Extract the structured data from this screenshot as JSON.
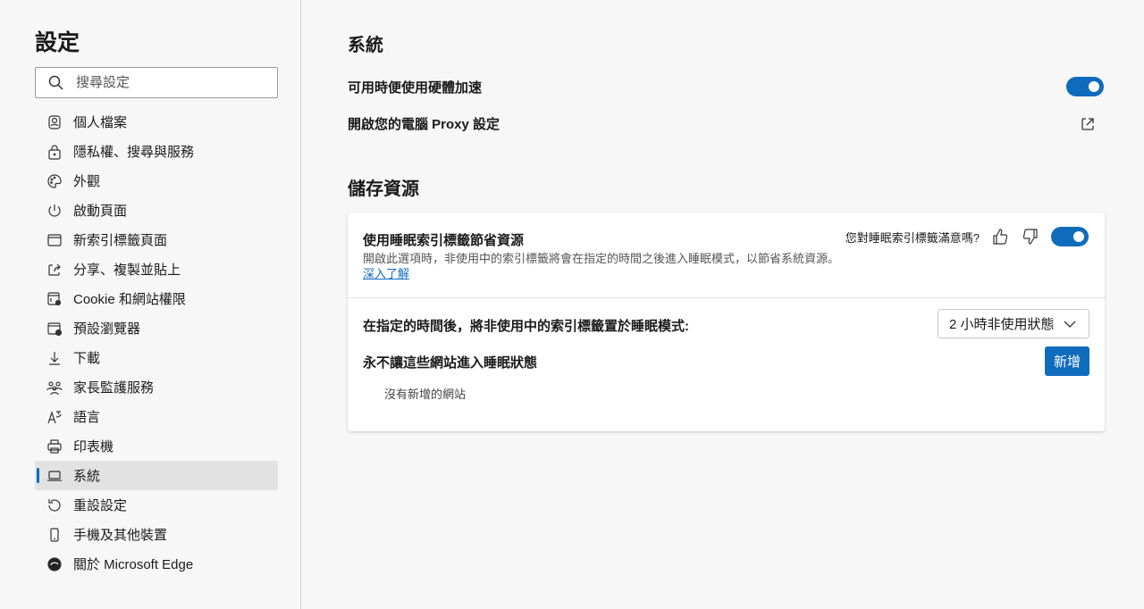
{
  "sidebar": {
    "title": "設定",
    "search_placeholder": "搜尋設定",
    "items": [
      {
        "label": "個人檔案",
        "icon": "profile-icon"
      },
      {
        "label": "隱私權、搜尋與服務",
        "icon": "lock-icon"
      },
      {
        "label": "外觀",
        "icon": "palette-icon"
      },
      {
        "label": "啟動頁面",
        "icon": "power-icon"
      },
      {
        "label": "新索引標籤頁面",
        "icon": "new-tab-icon"
      },
      {
        "label": "分享、複製並貼上",
        "icon": "share-icon"
      },
      {
        "label": "Cookie 和網站權限",
        "icon": "cookie-settings-icon"
      },
      {
        "label": "預設瀏覽器",
        "icon": "default-browser-icon"
      },
      {
        "label": "下載",
        "icon": "download-icon"
      },
      {
        "label": "家長監護服務",
        "icon": "family-icon"
      },
      {
        "label": "語言",
        "icon": "language-icon"
      },
      {
        "label": "印表機",
        "icon": "printer-icon"
      },
      {
        "label": "系統",
        "icon": "laptop-icon",
        "active": true
      },
      {
        "label": "重設設定",
        "icon": "reset-icon"
      },
      {
        "label": "手機及其他裝置",
        "icon": "phone-icon"
      },
      {
        "label": "關於 Microsoft Edge",
        "icon": "edge-logo-icon"
      }
    ]
  },
  "main": {
    "system_heading": "系統",
    "hardware_accel": {
      "label": "可用時便使用硬體加速",
      "enabled": true
    },
    "proxy": {
      "label": "開啟您的電腦 Proxy 設定"
    },
    "resources_heading": "儲存資源",
    "sleeping_tabs": {
      "title": "使用睡眠索引標籤節省資源",
      "description": "開啟此選項時，非使用中的索引標籤將會在指定的時間之後進入睡眠模式，以節省系統資源。",
      "learn_more": "深入了解",
      "feedback": "您對睡眠索引標籤滿意嗎?",
      "enabled": true
    },
    "sleep_after": {
      "label": "在指定的時間後，將非使用中的索引標籤置於睡眠模式:",
      "value": "2 小時非使用狀態"
    },
    "never_sleep": {
      "label": "永不讓這些網站進入睡眠狀態",
      "add_button": "新增",
      "empty": "沒有新增的網站"
    }
  },
  "colors": {
    "accent": "#0f6cbd"
  }
}
